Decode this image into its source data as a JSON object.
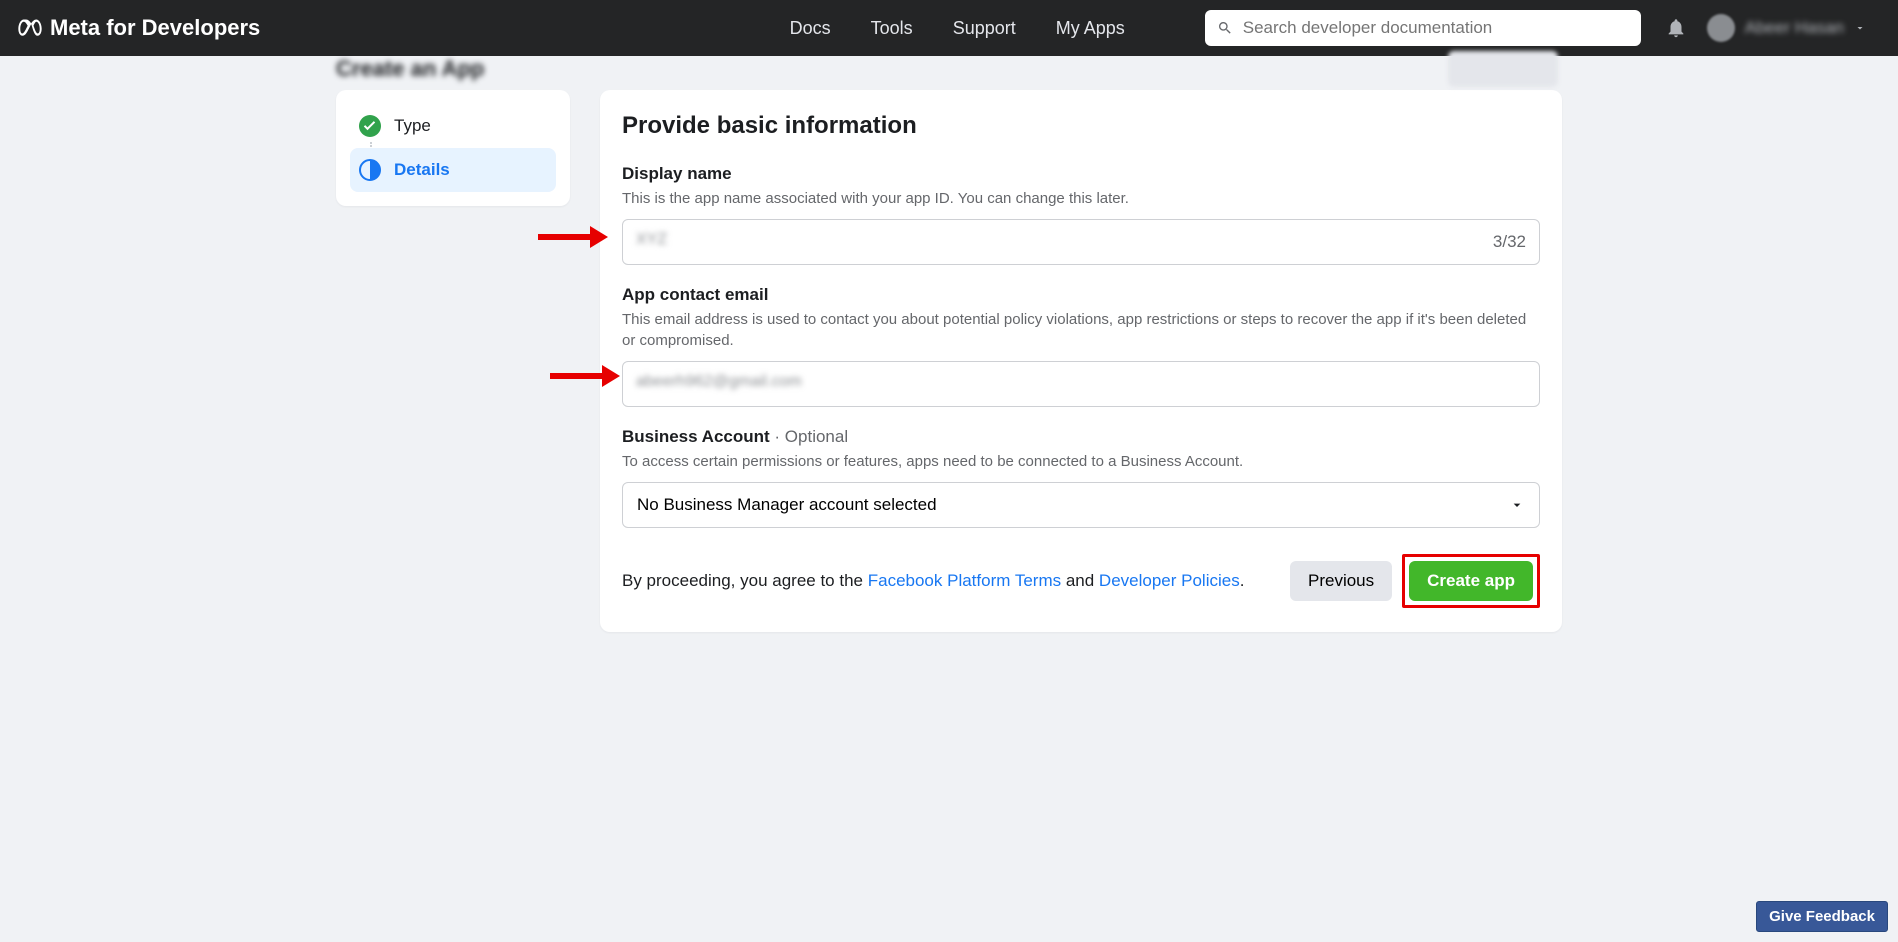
{
  "header": {
    "brand": "Meta for Developers",
    "nav": [
      "Docs",
      "Tools",
      "Support",
      "My Apps"
    ],
    "search_placeholder": "Search developer documentation",
    "username": "Abeer Hasan"
  },
  "subheader": {
    "title": "Create an App"
  },
  "sidebar": {
    "step1": "Type",
    "step2": "Details"
  },
  "form": {
    "title": "Provide basic information",
    "display_name": {
      "label": "Display name",
      "help": "This is the app name associated with your app ID. You can change this later.",
      "value": "XYZ",
      "counter": "3/32"
    },
    "contact_email": {
      "label": "App contact email",
      "help": "This email address is used to contact you about potential policy violations, app restrictions or steps to recover the app if it's been deleted or compromised.",
      "value": "abeerh962@gmail.com"
    },
    "business": {
      "label": "Business Account",
      "optional": " · Optional",
      "help": "To access certain permissions or features, apps need to be connected to a Business Account.",
      "selected": "No Business Manager account selected"
    },
    "agree_prefix": "By proceeding, you agree to the ",
    "terms_link": "Facebook Platform Terms",
    "agree_mid": " and ",
    "policies_link": "Developer Policies",
    "agree_suffix": ".",
    "previous_btn": "Previous",
    "create_btn": "Create app"
  },
  "feedback_btn": "Give Feedback"
}
